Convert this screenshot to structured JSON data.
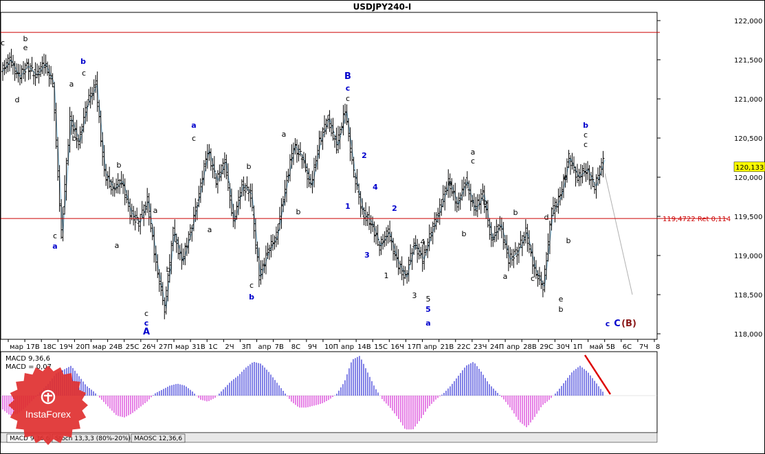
{
  "chart_title": "USDJPY240-I",
  "chart_data": {
    "type": "candlestick",
    "title": "USDJPY240-I",
    "ylim": [
      117.9,
      122.1
    ],
    "y_ticks": [
      "122,000",
      "121,500",
      "121,000",
      "120,500",
      "120,000",
      "119,500",
      "119,000",
      "118,500",
      "118,000"
    ],
    "y_tick_values": [
      122.0,
      121.5,
      121.0,
      120.5,
      120.0,
      119.5,
      119.0,
      118.5,
      118.0
    ],
    "current_price": "120,133",
    "current_price_value": 120.133,
    "resistance_level": 121.85,
    "retracement": {
      "value": 119.4722,
      "label": "119,4722 Ret 0,114"
    },
    "x_ticks": [
      "мар",
      "17В",
      "18С",
      "19Ч",
      "20П",
      "мар",
      "24В",
      "25С",
      "26Ч",
      "27П",
      "мар",
      "31В",
      "1С",
      "2Ч",
      "3П",
      "апр",
      "7В",
      "8С",
      "9Ч",
      "10П",
      "апр",
      "14В",
      "15С",
      "16Ч",
      "17П",
      "апр",
      "21В",
      "22С",
      "23Ч",
      "24П",
      "апр",
      "28В",
      "29С",
      "30Ч",
      "1П",
      "май",
      "5В",
      "6С",
      "7Ч",
      "8"
    ],
    "price_path": [
      121.35,
      121.5,
      121.28,
      121.42,
      121.3,
      121.45,
      121.2,
      119.28,
      120.75,
      120.45,
      120.95,
      121.18,
      120.05,
      119.85,
      119.95,
      119.55,
      119.42,
      119.7,
      118.9,
      118.32,
      119.3,
      118.92,
      119.3,
      119.78,
      120.35,
      119.95,
      120.2,
      119.42,
      119.9,
      119.78,
      118.72,
      119.05,
      119.25,
      119.85,
      120.4,
      120.25,
      119.88,
      120.45,
      120.75,
      120.4,
      120.85,
      120.05,
      119.55,
      119.42,
      119.12,
      119.3,
      118.92,
      118.72,
      119.15,
      118.95,
      119.3,
      119.6,
      119.95,
      119.65,
      119.95,
      119.58,
      119.78,
      119.2,
      119.4,
      118.95,
      119.05,
      119.3,
      118.82,
      118.6,
      119.55,
      119.75,
      120.25,
      120.0,
      120.1,
      119.88,
      120.22
    ],
    "forecast": [
      [
        118.5,
        120.05
      ]
    ],
    "wave_labels": [
      {
        "t": "c",
        "color": "#000000"
      },
      {
        "t": "b",
        "color": "#000000"
      },
      {
        "t": "e",
        "color": "#000000"
      },
      {
        "t": "d",
        "color": "#000000"
      },
      {
        "t": "b",
        "color": "#0000cc"
      },
      {
        "t": "c",
        "color": "#000000"
      },
      {
        "t": "a",
        "color": "#000000"
      },
      {
        "t": "b",
        "color": "#000000"
      },
      {
        "t": "c",
        "color": "#000000"
      },
      {
        "t": "a",
        "color": "#0000cc"
      },
      {
        "t": "b",
        "color": "#000000"
      },
      {
        "t": "a",
        "color": "#000000"
      },
      {
        "t": "a",
        "color": "#000000"
      },
      {
        "t": "b",
        "color": "#000000"
      },
      {
        "t": "c",
        "color": "#000000"
      },
      {
        "t": "c",
        "color": "#0000cc"
      },
      {
        "t": "A",
        "color": "#0000cc"
      },
      {
        "t": "a",
        "color": "#0000cc"
      },
      {
        "t": "c",
        "color": "#000000"
      },
      {
        "t": "a",
        "color": "#000000"
      },
      {
        "t": "b",
        "color": "#000000"
      },
      {
        "t": "c",
        "color": "#000000"
      },
      {
        "t": "b",
        "color": "#0000cc"
      },
      {
        "t": "a",
        "color": "#000000"
      },
      {
        "t": "b",
        "color": "#000000"
      },
      {
        "t": "B",
        "color": "#0000cc"
      },
      {
        "t": "c",
        "color": "#0000cc"
      },
      {
        "t": "c",
        "color": "#000000"
      },
      {
        "t": "2",
        "color": "#0000cc"
      },
      {
        "t": "1",
        "color": "#0000cc"
      },
      {
        "t": "4",
        "color": "#0000cc"
      },
      {
        "t": "3",
        "color": "#0000cc"
      },
      {
        "t": "2",
        "color": "#0000cc"
      },
      {
        "t": "1",
        "color": "#000000"
      },
      {
        "t": "4",
        "color": "#000000"
      },
      {
        "t": "3",
        "color": "#000000"
      },
      {
        "t": "5",
        "color": "#000000"
      },
      {
        "t": "5",
        "color": "#0000cc"
      },
      {
        "t": "a",
        "color": "#0000cc"
      },
      {
        "t": "a",
        "color": "#000000"
      },
      {
        "t": "b",
        "color": "#000000"
      },
      {
        "t": "a",
        "color": "#000000"
      },
      {
        "t": "c",
        "color": "#000000"
      },
      {
        "t": "b",
        "color": "#000000"
      },
      {
        "t": "b",
        "color": "#000000"
      },
      {
        "t": "a",
        "color": "#000000"
      },
      {
        "t": "c",
        "color": "#000000"
      },
      {
        "t": "d",
        "color": "#000000"
      },
      {
        "t": "a",
        "color": "#000000"
      },
      {
        "t": "b",
        "color": "#000000"
      },
      {
        "t": "e",
        "color": "#000000"
      },
      {
        "t": "b",
        "color": "#000000"
      },
      {
        "t": "b",
        "color": "#0000cc"
      },
      {
        "t": "c",
        "color": "#000000"
      },
      {
        "t": "c",
        "color": "#000000"
      },
      {
        "t": "c",
        "color": "#0000cc"
      },
      {
        "t": "C",
        "color": "#0000cc"
      },
      {
        "t": "(B)",
        "color": "#8b1a1a"
      }
    ],
    "macd": {
      "label1": "MACD 9,36,6",
      "label2": "MACD = 0,07",
      "histogram": [
        -0.35,
        -0.5,
        -0.45,
        -0.3,
        -0.1,
        0.1,
        0.3,
        0.55,
        0.65,
        0.75,
        0.5,
        0.25,
        0.1,
        -0.1,
        -0.3,
        -0.5,
        -0.55,
        -0.45,
        -0.3,
        -0.15,
        0.05,
        0.15,
        0.25,
        0.3,
        0.25,
        0.1,
        -0.1,
        -0.15,
        -0.05,
        0.15,
        0.35,
        0.5,
        0.7,
        0.85,
        0.8,
        0.6,
        0.35,
        0.1,
        -0.15,
        -0.3,
        -0.3,
        -0.25,
        -0.2,
        -0.1,
        0.05,
        0.35,
        0.9,
        1.0,
        0.6,
        0.2,
        -0.1,
        -0.3,
        -0.55,
        -0.85,
        -0.85,
        -0.6,
        -0.3,
        -0.1,
        0.05,
        0.25,
        0.5,
        0.75,
        0.85,
        0.6,
        0.3,
        0.1,
        -0.1,
        -0.35,
        -0.65,
        -0.8,
        -0.55,
        -0.25,
        -0.1,
        0.1,
        0.35,
        0.6,
        0.75,
        0.6,
        0.35,
        0.1
      ],
      "tabs": [
        "MACD 9,36,6",
        "Stoch 13,3,3 (80%-20%)",
        "MAOSC 12,36,6"
      ]
    },
    "colors": {
      "resistance": "#cc0000",
      "retracement_line": "#cc0000",
      "zigzag": "#7fb8d8",
      "macd_positive": "#0000cc",
      "macd_negative": "#cc00cc",
      "macd_trend": "#dd0000",
      "price_badge": "#ffff00",
      "logo": "#e03030"
    }
  },
  "logo_text": "InstaForex"
}
